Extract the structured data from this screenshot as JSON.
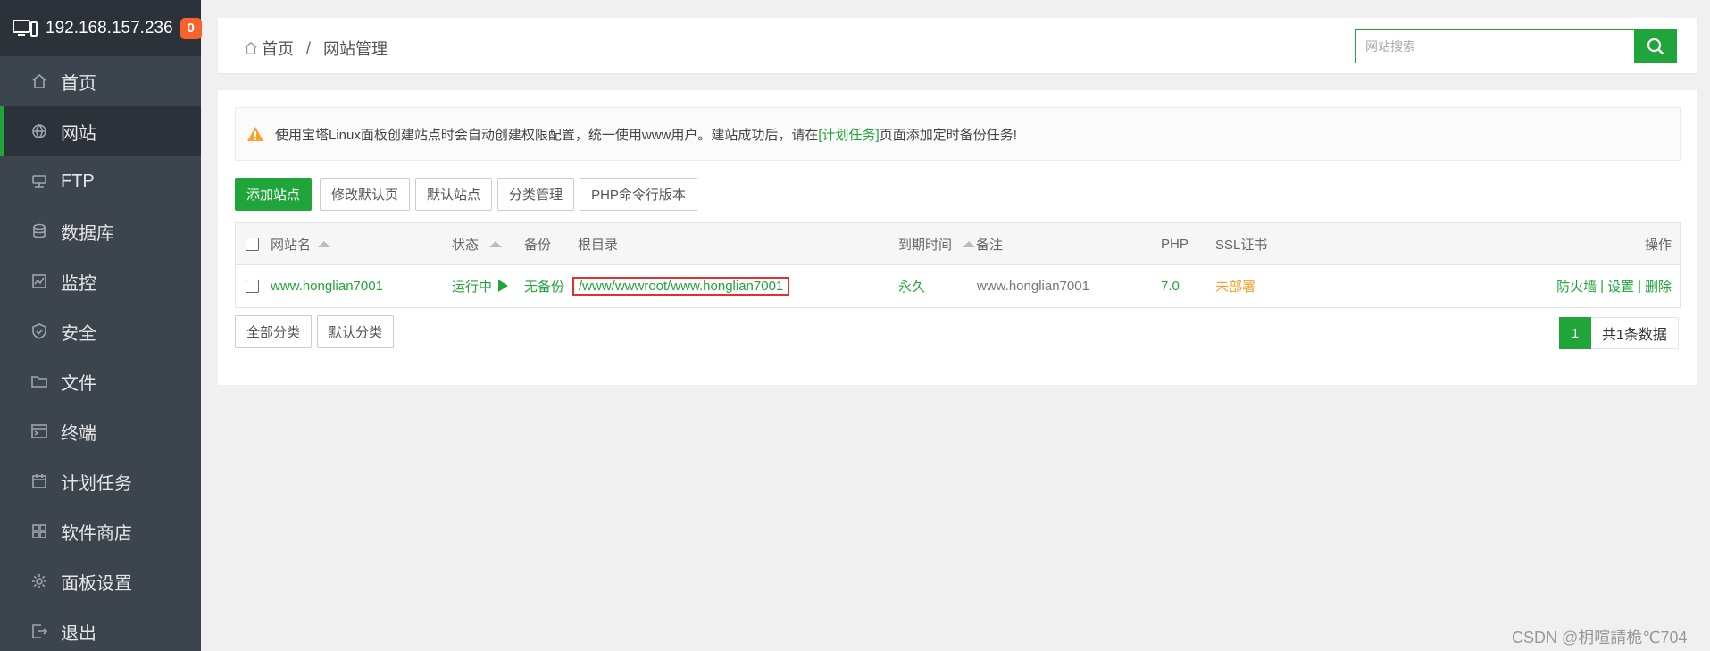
{
  "sidebar": {
    "ip": "192.168.157.236",
    "badge": "0",
    "items": [
      {
        "label": "首页",
        "icon": "home-icon"
      },
      {
        "label": "网站",
        "icon": "globe-icon"
      },
      {
        "label": "FTP",
        "icon": "ftp-icon"
      },
      {
        "label": "数据库",
        "icon": "database-icon"
      },
      {
        "label": "监控",
        "icon": "monitor-icon"
      },
      {
        "label": "安全",
        "icon": "shield-icon"
      },
      {
        "label": "文件",
        "icon": "folder-icon"
      },
      {
        "label": "终端",
        "icon": "terminal-icon"
      },
      {
        "label": "计划任务",
        "icon": "calendar-icon"
      },
      {
        "label": "软件商店",
        "icon": "grid-icon"
      },
      {
        "label": "面板设置",
        "icon": "gear-icon"
      },
      {
        "label": "退出",
        "icon": "logout-icon"
      }
    ],
    "active_index": 1
  },
  "header": {
    "breadcrumb_home": "首页",
    "breadcrumb_sep": "/",
    "breadcrumb_current": "网站管理",
    "search_placeholder": "网站搜索"
  },
  "notice": {
    "text_before": "使用宝塔Linux面板创建站点时会自动创建权限配置，统一使用www用户。建站成功后，请在",
    "link": "[计划任务]",
    "text_after": "页面添加定时备份任务!"
  },
  "toolbar": {
    "add_site": "添加站点",
    "modify_default_page": "修改默认页",
    "default_site": "默认站点",
    "category_manage": "分类管理",
    "php_cli_version": "PHP命令行版本"
  },
  "table": {
    "headers": {
      "name": "网站名",
      "status": "状态",
      "backup": "备份",
      "root": "根目录",
      "expire": "到期时间",
      "remark": "备注",
      "php": "PHP",
      "ssl": "SSL证书",
      "actions": "操作"
    },
    "rows": [
      {
        "name": "www.honglian7001",
        "status": "运行中",
        "backup": "无备份",
        "root": "/www/wwwroot/www.honglian7001",
        "expire": "永久",
        "remark": "www.honglian7001",
        "php": "7.0",
        "ssl": "未部署",
        "action_firewall": "防火墙",
        "action_settings": "设置",
        "action_delete": "删除",
        "action_sep": "|"
      }
    ]
  },
  "bottom": {
    "all_categories": "全部分类",
    "default_category": "默认分类",
    "page": "1",
    "total": "共1条数据"
  },
  "watermark": "CSDN @枂喧請桅℃704",
  "colors": {
    "accent": "#20a53a",
    "sidebar": "#3c444d",
    "badge": "#f7632b",
    "warn": "#f8a22c",
    "highlight": "#e52e2e"
  }
}
